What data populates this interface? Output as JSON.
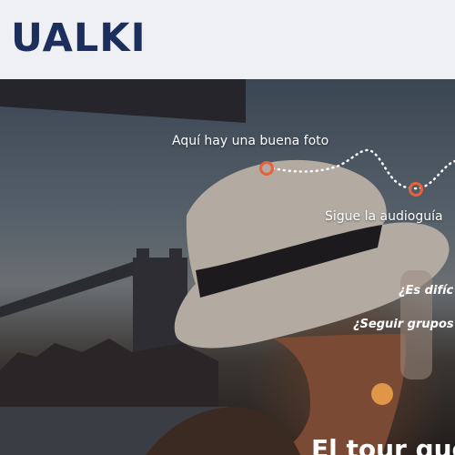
{
  "header": {
    "logo_text": "UALKI"
  },
  "hero": {
    "annotations": {
      "photo_spot": "Aquí hay una buena foto",
      "audioguide": "Sigue la audioguía"
    },
    "questions": {
      "difficult": "¿Es difíc",
      "follow_groups": "¿Seguir grupos"
    },
    "headline": "El tour que"
  },
  "colors": {
    "header_bg": "#eef0f4",
    "logo": "#1c2f5c",
    "marker": "#e8613c",
    "dots": "#ffffff"
  }
}
